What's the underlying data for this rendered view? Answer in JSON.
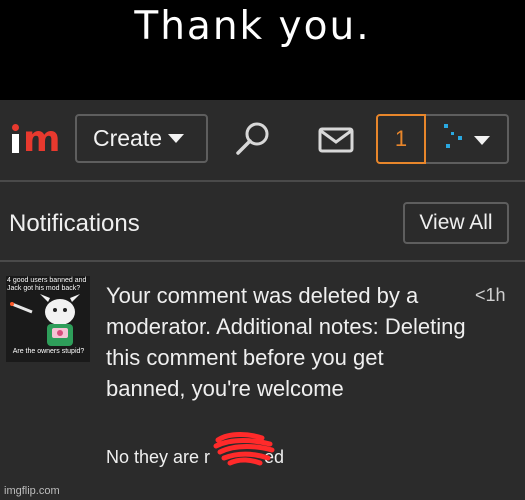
{
  "caption": "Thank you.",
  "header": {
    "logo_text": "im",
    "create_label": "Create",
    "notif_count": "1"
  },
  "notifications": {
    "title": "Notifications",
    "view_all": "View All",
    "item": {
      "thumb_top": "4 good users banned and Jack got his mod back?",
      "thumb_bottom": "Are the owners stupid?",
      "message": "Your comment was deleted by a moderator. Additional notes: Deleting this comment before you get banned, you're welcome",
      "time": "<1h",
      "reply_text": "No they are r   ed"
    }
  },
  "watermark": "imgflip.com",
  "colors": {
    "accent": "#e8862b",
    "logo_red": "#e8392e",
    "scribble_red": "#ff2a2a"
  }
}
